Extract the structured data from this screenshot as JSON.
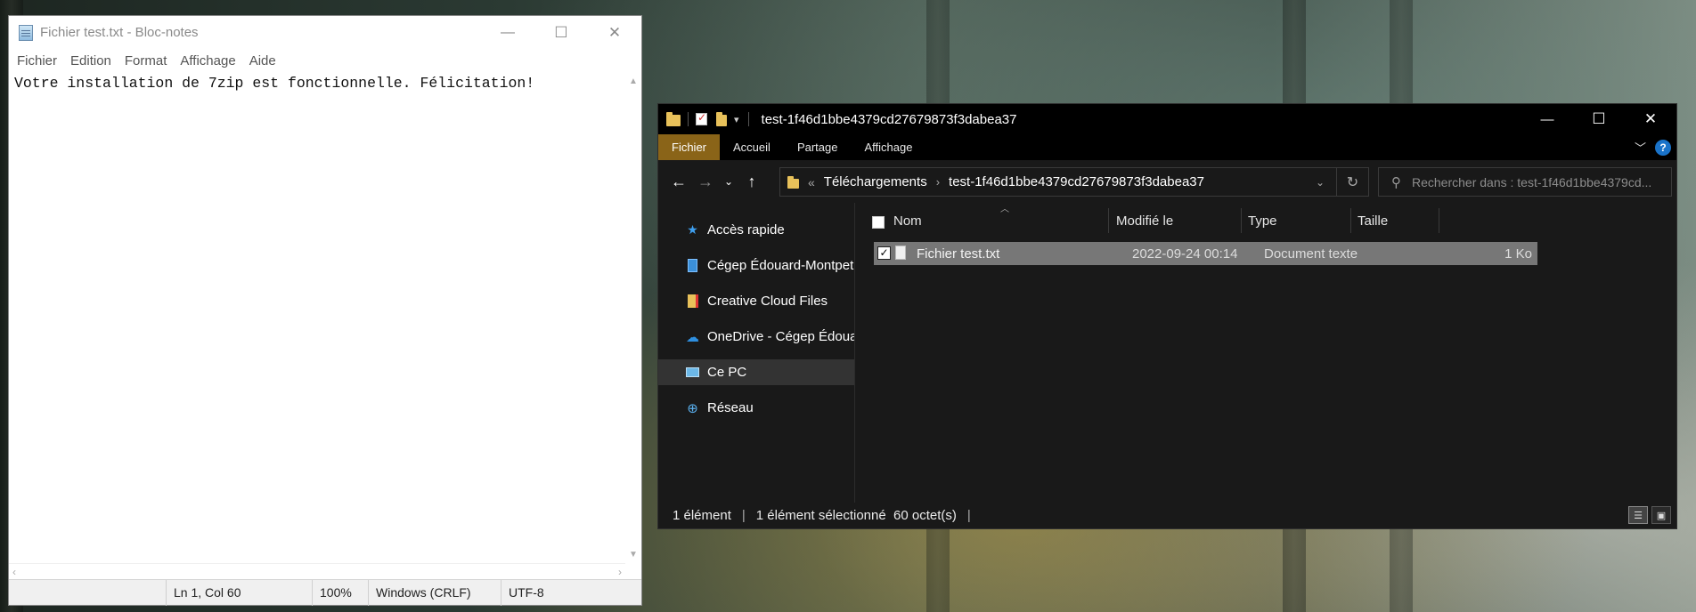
{
  "notepad": {
    "title": "Fichier test.txt - Bloc-notes",
    "menu": [
      "Fichier",
      "Edition",
      "Format",
      "Affichage",
      "Aide"
    ],
    "content": "Votre installation de 7zip est fonctionnelle. Félicitation!",
    "status": {
      "position": "Ln 1, Col 60",
      "zoom": "100%",
      "line_ending": "Windows (CRLF)",
      "encoding": "UTF-8"
    },
    "window_buttons": {
      "minimize": "—",
      "maximize": "☐",
      "close": "✕"
    }
  },
  "explorer": {
    "title": "test-1f46d1bbe4379cd27679873f3dabea37",
    "ribbon_tabs": [
      "Fichier",
      "Accueil",
      "Partage",
      "Affichage"
    ],
    "help": "?",
    "address": {
      "overflow": "«",
      "segments": [
        "Téléchargements",
        "test-1f46d1bbe4379cd27679873f3dabea37"
      ]
    },
    "search_placeholder": "Rechercher dans : test-1f46d1bbe4379cd...",
    "nav_pane": [
      {
        "label": "Accès rapide",
        "icon": "star-icon"
      },
      {
        "label": "Cégep Édouard-Montpetit",
        "icon": "building-icon"
      },
      {
        "label": "Creative Cloud Files",
        "icon": "creative-cloud-icon"
      },
      {
        "label": "OneDrive - Cégep Édouard-Montpetit",
        "icon": "onedrive-cloud-icon"
      },
      {
        "label": "Ce PC",
        "icon": "computer-icon"
      },
      {
        "label": "Réseau",
        "icon": "network-icon"
      }
    ],
    "columns": [
      "Nom",
      "Modifié le",
      "Type",
      "Taille"
    ],
    "files": [
      {
        "name": "Fichier test.txt",
        "modified": "2022-09-24 00:14",
        "type": "Document texte",
        "size": "1 Ko"
      }
    ],
    "status": {
      "count": "1 élément",
      "selected": "1 élément sélectionné  60 octet(s)"
    },
    "window_buttons": {
      "minimize": "—",
      "maximize": "☐",
      "close": "✕"
    }
  }
}
